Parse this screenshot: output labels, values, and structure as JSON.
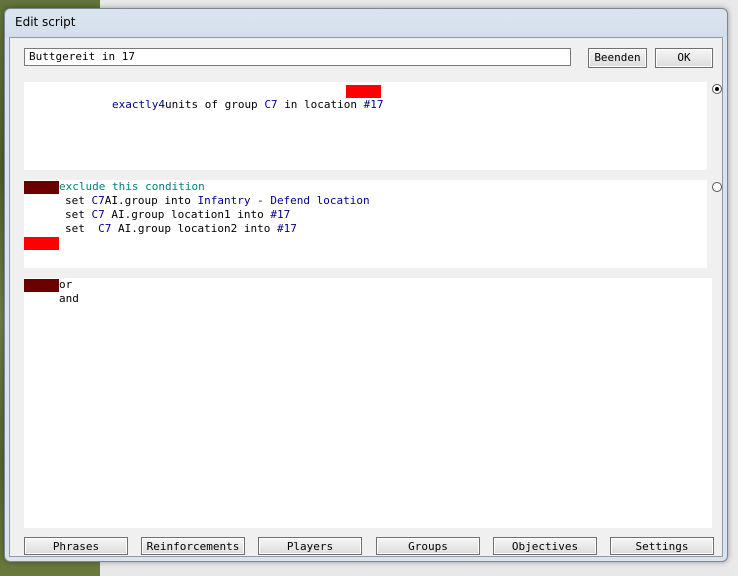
{
  "window": {
    "title": "Edit script"
  },
  "header": {
    "script_name": "Buttgereit in 17",
    "beenden_label": "Beenden",
    "ok_label": "OK"
  },
  "condition": {
    "word1": "exactly",
    "count": "4",
    "word2": "units of group",
    "group": "C7",
    "word3": "in location",
    "location": "#17"
  },
  "action": {
    "header": "exclude this condition",
    "l1a": "set ",
    "l1b": "C7",
    "l1c": "AI.group into ",
    "l1d": "Infantry - Defend location",
    "l2a": "set ",
    "l2b": "C7",
    "l2c": " AI.group location1 into ",
    "l2d": "#17",
    "l3a": "set  ",
    "l3b": "C7",
    "l3c": " AI.group location2 into ",
    "l3d": "#17"
  },
  "logic": {
    "or": "or",
    "and": "and"
  },
  "bottom_tabs": [
    "Phrases",
    "Reinforcements",
    "Players",
    "Groups",
    "Objectives",
    "Settings"
  ],
  "colors": {
    "bright_red": "#ff0000",
    "dark_red": "#6b0000",
    "keyword_blue": "#00008b",
    "teal": "#008080"
  }
}
